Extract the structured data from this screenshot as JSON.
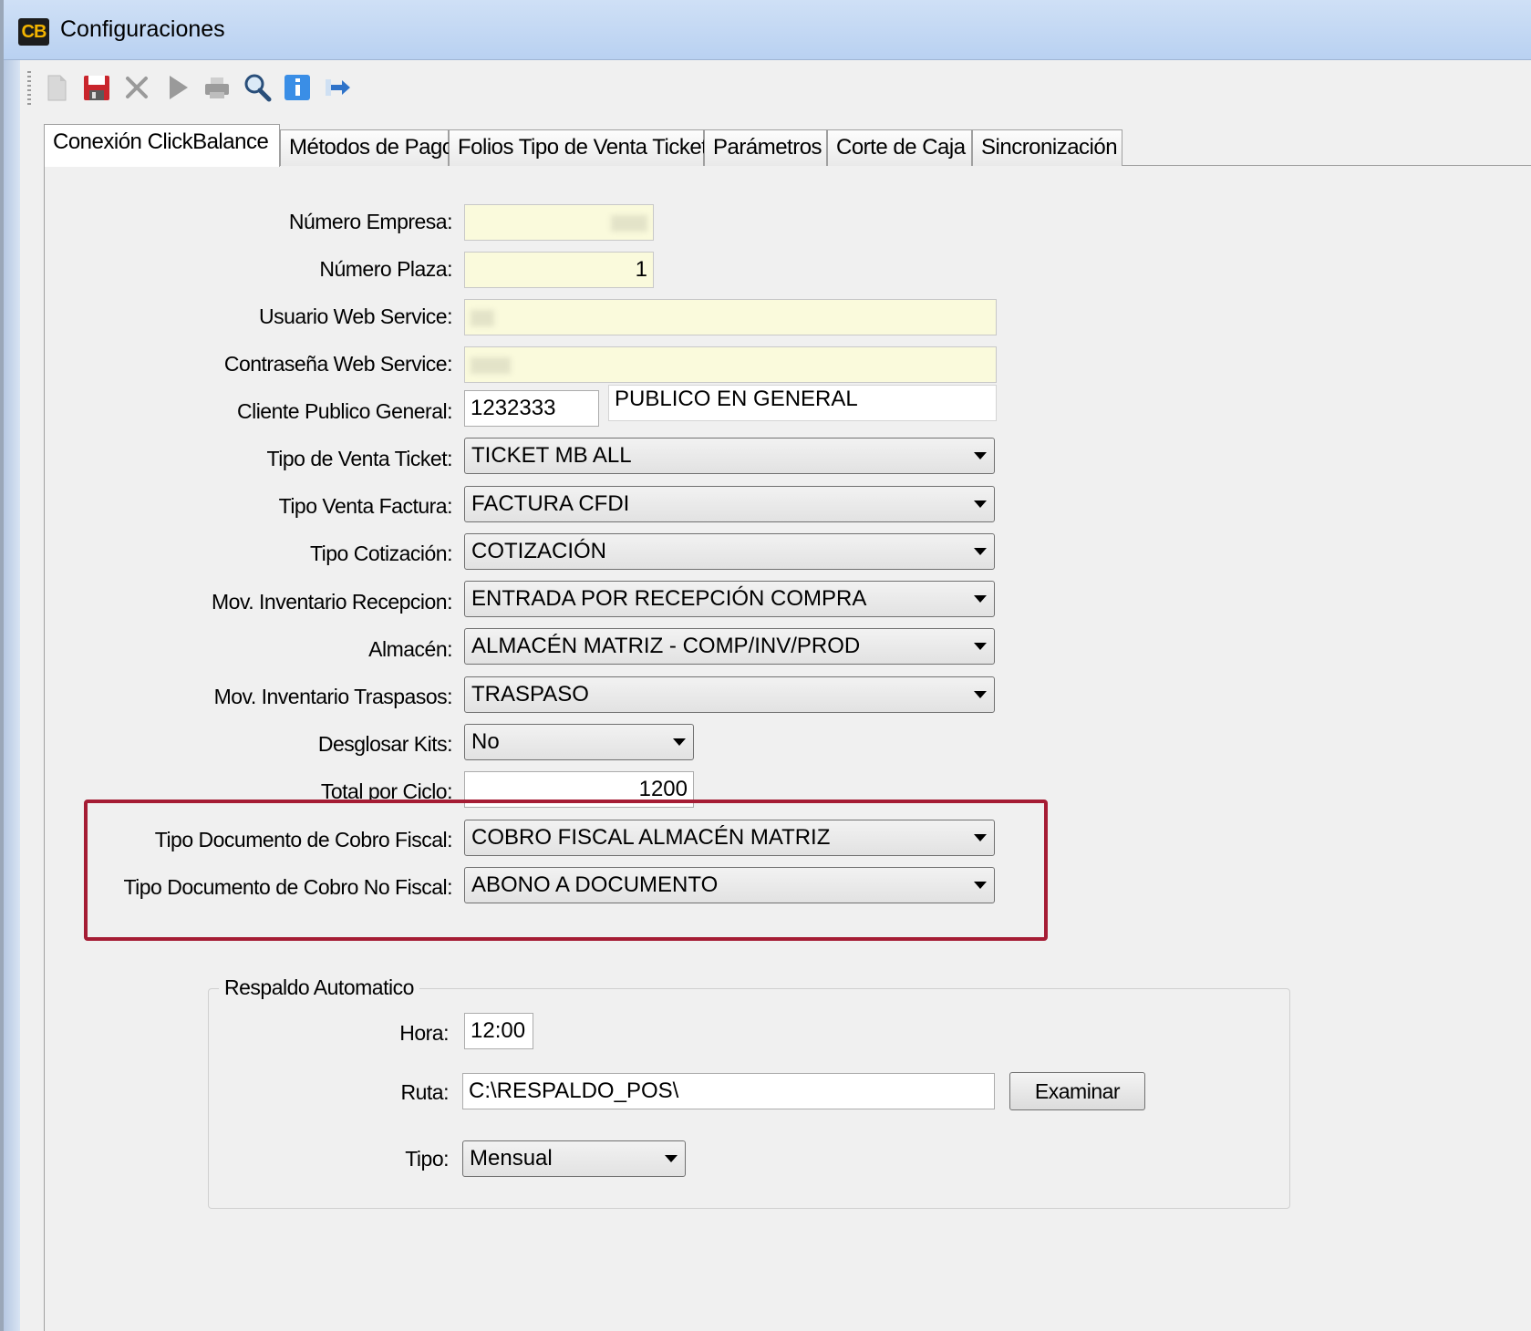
{
  "window": {
    "title": "Configuraciones",
    "icon_text": "CB"
  },
  "toolbar": {
    "buttons": [
      "new-icon",
      "save-icon",
      "delete-icon",
      "run-icon",
      "print-icon",
      "search-icon",
      "info-icon",
      "exit-icon"
    ]
  },
  "tabs": [
    {
      "label": "Conexión ClickBalance"
    },
    {
      "label": "Métodos de Pago"
    },
    {
      "label": "Folios Tipo de Venta Ticket"
    },
    {
      "label": "Parámetros"
    },
    {
      "label": "Corte de Caja"
    },
    {
      "label": "Sincronización"
    }
  ],
  "form": {
    "numero_empresa": {
      "label": "Número Empresa:",
      "value": ""
    },
    "numero_plaza": {
      "label": "Número Plaza:",
      "value": "1"
    },
    "usuario_ws": {
      "label": "Usuario Web Service:",
      "value": ""
    },
    "contrasena_ws": {
      "label": "Contraseña Web Service:",
      "value": ""
    },
    "cliente_publico": {
      "label": "Cliente Publico General:",
      "value": "1232333",
      "name": "PUBLICO EN GENERAL"
    },
    "tipo_venta_ticket": {
      "label": "Tipo de Venta Ticket:",
      "value": "TICKET MB ALL"
    },
    "tipo_venta_factura": {
      "label": "Tipo Venta Factura:",
      "value": "FACTURA CFDI"
    },
    "tipo_cotizacion": {
      "label": "Tipo Cotización:",
      "value": "COTIZACIÓN"
    },
    "mov_inv_recepcion": {
      "label": "Mov. Inventario Recepcion:",
      "value": "ENTRADA POR RECEPCIÓN COMPRA"
    },
    "almacen": {
      "label": "Almacén:",
      "value": "ALMACÉN MATRIZ - COMP/INV/PROD"
    },
    "mov_inv_traspasos": {
      "label": "Mov. Inventario Traspasos:",
      "value": "TRASPASO"
    },
    "desglosar_kits": {
      "label": "Desglosar Kits:",
      "value": "No"
    },
    "total_por_ciclo": {
      "label": "Total por Ciclo:",
      "value": "1200"
    },
    "cobro_fiscal": {
      "label": "Tipo Documento de Cobro Fiscal:",
      "value": "COBRO FISCAL ALMACÉN MATRIZ"
    },
    "cobro_no_fiscal": {
      "label": "Tipo Documento de Cobro No Fiscal:",
      "value": "ABONO A DOCUMENTO"
    }
  },
  "respaldo": {
    "title": "Respaldo Automatico",
    "hora": {
      "label": "Hora:",
      "value": "12:00"
    },
    "ruta": {
      "label": "Ruta:",
      "value": "C:\\RESPALDO_POS\\"
    },
    "examinar": "Examinar",
    "tipo": {
      "label": "Tipo:",
      "value": "Mensual"
    }
  },
  "colors": {
    "highlight_border": "#a51c34",
    "readonly_field": "#fafadc"
  }
}
